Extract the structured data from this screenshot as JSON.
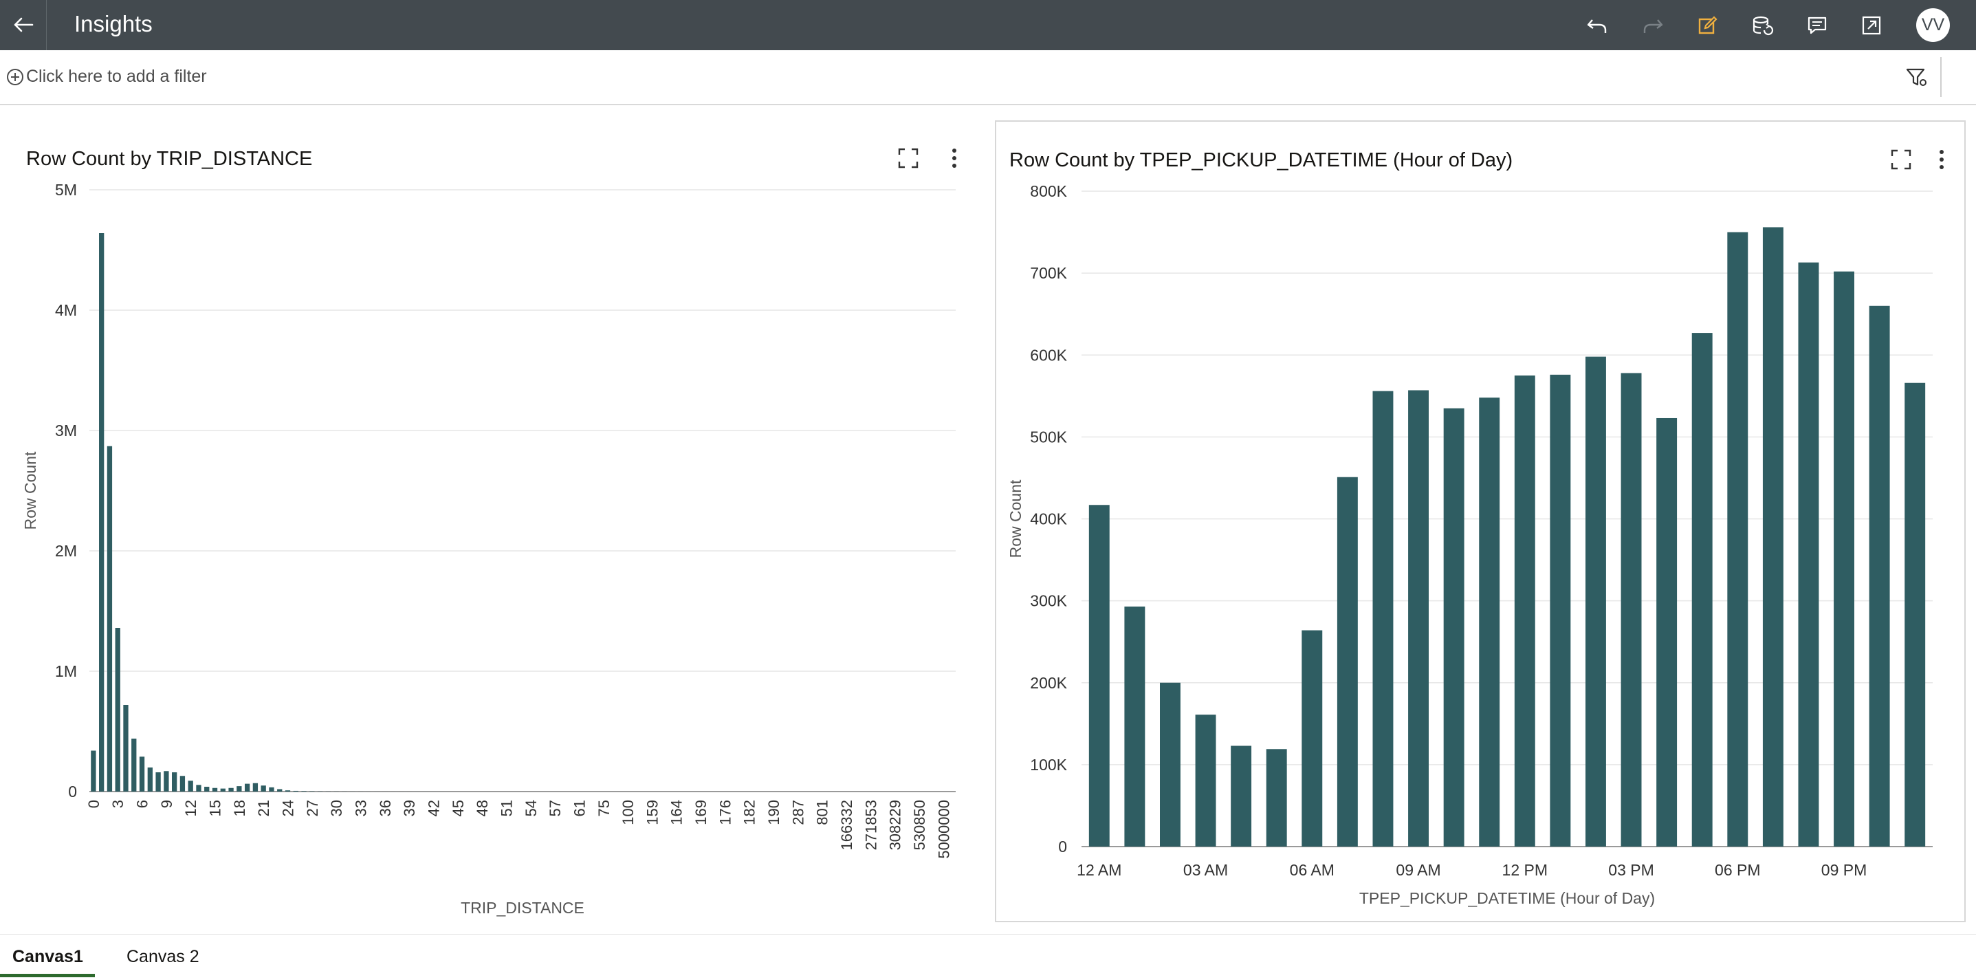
{
  "header": {
    "title": "Insights",
    "avatar_initials": "VV",
    "background": "#434a4f",
    "accent": "#f0b03f"
  },
  "filter_bar": {
    "add_filter_text": "Click here to add a filter"
  },
  "tabs": [
    {
      "label": "Canvas1",
      "active": true
    },
    {
      "label": "Canvas 2",
      "active": false
    }
  ],
  "chart_data": [
    {
      "type": "bar",
      "title": "Row Count by TRIP_DISTANCE",
      "xlabel": "TRIP_DISTANCE",
      "ylabel": "Row Count",
      "ylim": [
        0,
        5000000
      ],
      "yticks": [
        {
          "v": 0,
          "label": "0"
        },
        {
          "v": 1000000,
          "label": "1M"
        },
        {
          "v": 2000000,
          "label": "2M"
        },
        {
          "v": 3000000,
          "label": "3M"
        },
        {
          "v": 4000000,
          "label": "4M"
        },
        {
          "v": 5000000,
          "label": "5M"
        }
      ],
      "x_tick_labels": [
        "0",
        "3",
        "6",
        "9",
        "12",
        "15",
        "18",
        "21",
        "24",
        "27",
        "30",
        "33",
        "36",
        "39",
        "42",
        "45",
        "48",
        "51",
        "54",
        "57",
        "61",
        "75",
        "100",
        "159",
        "164",
        "169",
        "176",
        "182",
        "190",
        "287",
        "801",
        "166332",
        "271853",
        "308229",
        "530850",
        "5000000"
      ],
      "tick_every": 3,
      "color": "#2f5d62",
      "values": [
        340000,
        4640000,
        2870000,
        1360000,
        720000,
        440000,
        290000,
        200000,
        160000,
        170000,
        160000,
        130000,
        90000,
        55000,
        40000,
        30000,
        25000,
        30000,
        45000,
        65000,
        70000,
        50000,
        35000,
        20000,
        10000,
        6000,
        4000,
        2500,
        1500,
        1000,
        800,
        600,
        400,
        300,
        200,
        150,
        120,
        100,
        80,
        60,
        50,
        40,
        30,
        30,
        20,
        20,
        15,
        15,
        10,
        10,
        10,
        8,
        8,
        6,
        6,
        5,
        5,
        4,
        4,
        3,
        3,
        3,
        2,
        2,
        2,
        2,
        1,
        1,
        1,
        1,
        1,
        1,
        1,
        1,
        1,
        1,
        1,
        1,
        1,
        1,
        1,
        1,
        1,
        1,
        1,
        1,
        1,
        1,
        1,
        1,
        1,
        1,
        1,
        1,
        1,
        1,
        1,
        1,
        1,
        1,
        1,
        1,
        1,
        1,
        1,
        1,
        1
      ]
    },
    {
      "type": "bar",
      "title": "Row Count by TPEP_PICKUP_DATETIME (Hour of Day)",
      "xlabel": "TPEP_PICKUP_DATETIME (Hour of Day)",
      "ylabel": "Row Count",
      "ylim": [
        0,
        800000
      ],
      "yticks": [
        {
          "v": 0,
          "label": "0"
        },
        {
          "v": 100000,
          "label": "100K"
        },
        {
          "v": 200000,
          "label": "200K"
        },
        {
          "v": 300000,
          "label": "300K"
        },
        {
          "v": 400000,
          "label": "400K"
        },
        {
          "v": 500000,
          "label": "500K"
        },
        {
          "v": 600000,
          "label": "600K"
        },
        {
          "v": 700000,
          "label": "700K"
        },
        {
          "v": 800000,
          "label": "800K"
        }
      ],
      "x_tick_labels": [
        "12 AM",
        "03 AM",
        "06 AM",
        "09 AM",
        "12 PM",
        "03 PM",
        "06 PM",
        "09 PM"
      ],
      "tick_every": 3,
      "color": "#2f5d62",
      "values": [
        417000,
        293000,
        200000,
        161000,
        123000,
        119000,
        264000,
        451000,
        556000,
        557000,
        535000,
        548000,
        575000,
        576000,
        598000,
        578000,
        523000,
        627000,
        750000,
        756000,
        713000,
        702000,
        660000,
        566000
      ]
    }
  ]
}
